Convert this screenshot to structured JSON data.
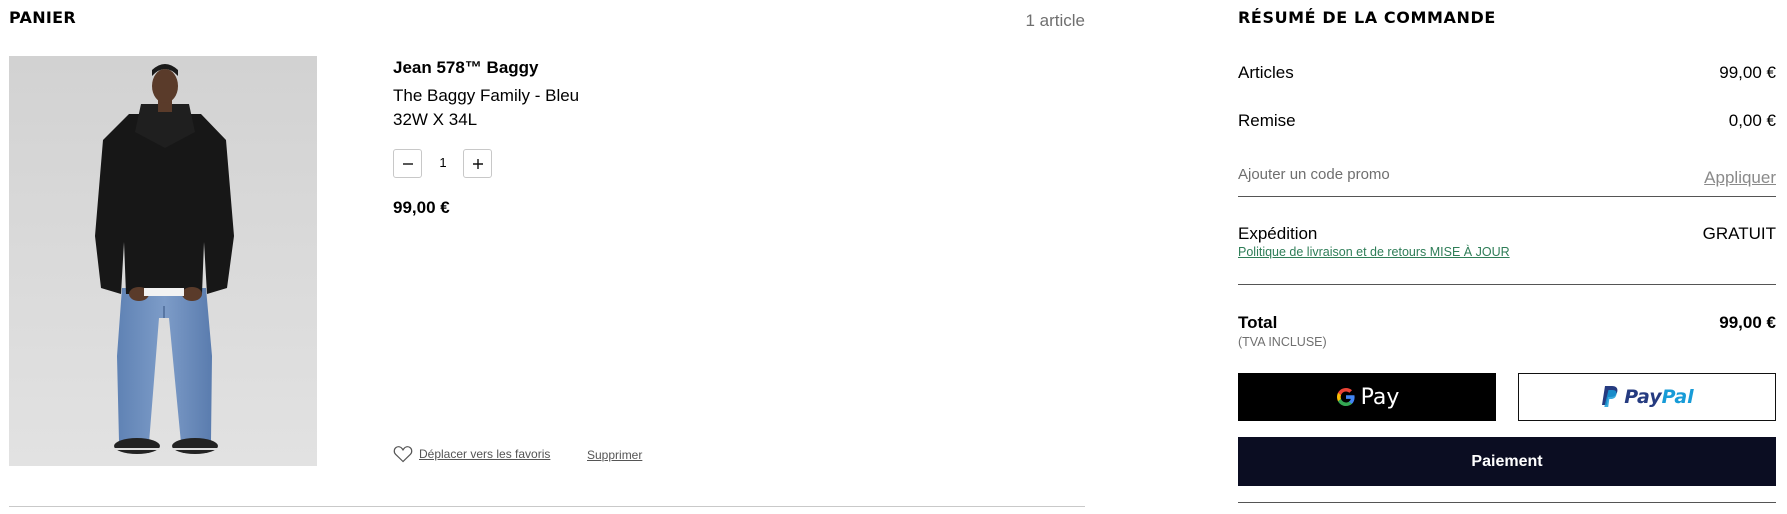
{
  "cart": {
    "title": "PANIER",
    "item_count": "1 article",
    "items": [
      {
        "name": "Jean 578™ Baggy",
        "variant": "The Baggy Family - Bleu",
        "size": "32W X 34L",
        "quantity": "1",
        "price": "99,00 €",
        "move_to_favorites": "Déplacer vers les favoris",
        "remove": "Supprimer"
      }
    ]
  },
  "summary": {
    "title": "RÉSUMÉ DE LA COMMANDE",
    "articles_label": "Articles",
    "articles_value": "99,00 €",
    "discount_label": "Remise",
    "discount_value": "0,00 €",
    "promo_placeholder": "Ajouter un code promo",
    "promo_apply": "Appliquer",
    "shipping_label": "Expédition",
    "shipping_value": "GRATUIT",
    "shipping_policy": "Politique de livraison et de retours MISE À JOUR",
    "total_label": "Total",
    "total_value": "99,00 €",
    "vat_note": "(TVA INCLUSE)",
    "gpay_label": "Pay",
    "paypal_label_1": "Pay",
    "paypal_label_2": "Pal",
    "checkout_label": "Paiement"
  },
  "icons": {
    "minus": "minus-icon",
    "plus": "plus-icon",
    "heart": "heart-icon",
    "google": "google-g-icon",
    "paypal": "paypal-p-icon"
  },
  "colors": {
    "checkout_bg": "#0b0d22",
    "policy_link": "#2e7d57",
    "paypal_dark": "#253b80",
    "paypal_light": "#179bd7"
  }
}
